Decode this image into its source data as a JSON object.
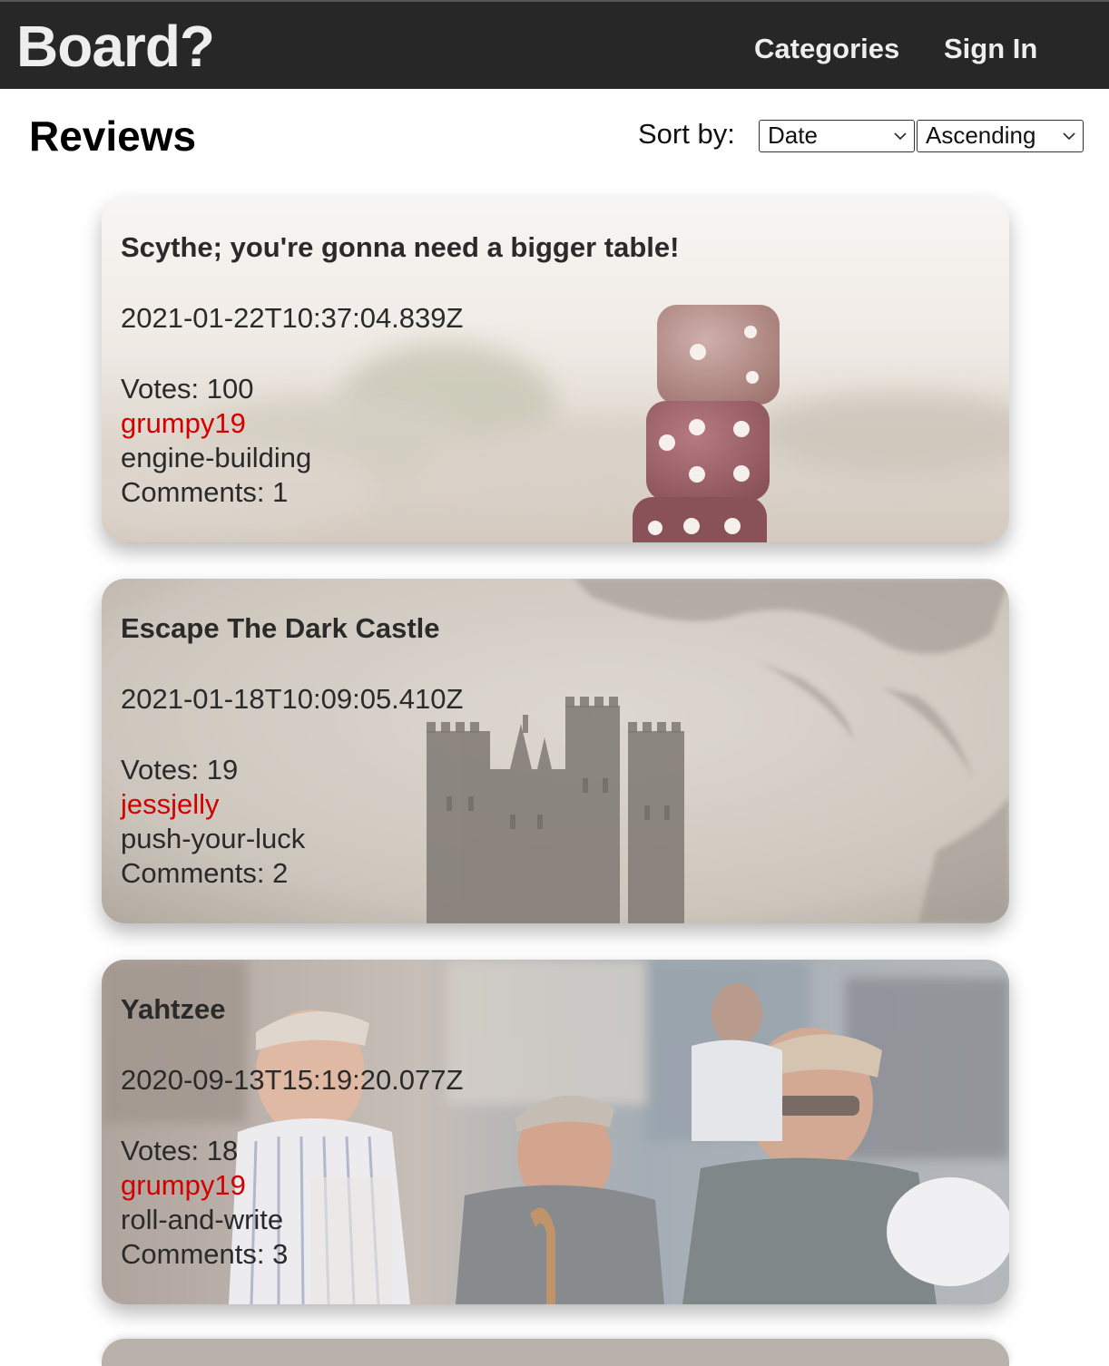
{
  "header": {
    "brand": "Board?",
    "nav": {
      "categories": "Categories",
      "sign_in": "Sign In"
    }
  },
  "main": {
    "title": "Reviews",
    "sort": {
      "label": "Sort by:",
      "field_selected": "Date",
      "order_selected": "Ascending"
    },
    "reviews": [
      {
        "title": "Scythe; you're gonna need a bigger table!",
        "created_at": "2021-01-22T10:37:04.839Z",
        "votes": "Votes: 100",
        "owner": "grumpy19",
        "category": "engine-building",
        "comments": "Comments: 1",
        "image": "dice-stack"
      },
      {
        "title": "Escape The Dark Castle",
        "created_at": "2021-01-18T10:09:05.410Z",
        "votes": "Votes: 19",
        "owner": "jessjelly",
        "category": "push-your-luck",
        "comments": "Comments: 2",
        "image": "dark-castle"
      },
      {
        "title": "Yahtzee",
        "created_at": "2020-09-13T15:19:20.077Z",
        "votes": "Votes: 18",
        "owner": "grumpy19",
        "category": "roll-and-write",
        "comments": "Comments: 3",
        "image": "old-men-playing"
      }
    ]
  },
  "colors": {
    "navbar": "#272727",
    "nav_text": "#eeeeee",
    "author": "#d40000"
  }
}
